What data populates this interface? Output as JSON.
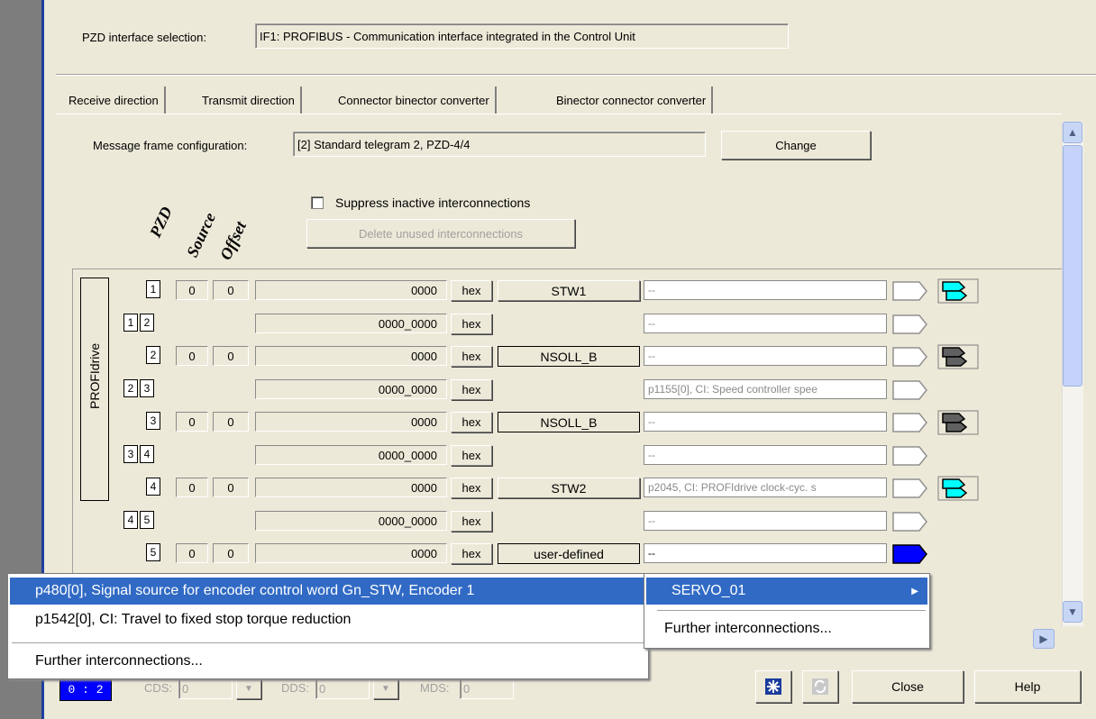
{
  "pzd_interface": {
    "label": "PZD interface selection:",
    "value": "IF1: PROFIBUS - Communication interface integrated in the Control Unit"
  },
  "tabs": [
    {
      "label": "Receive direction",
      "active": true
    },
    {
      "label": "Transmit direction",
      "active": false
    },
    {
      "label": "Connector binector converter",
      "active": false
    },
    {
      "label": "Binector connector converter",
      "active": false
    }
  ],
  "message_frame": {
    "label": "Message frame configuration:",
    "value": "[2] Standard telegram 2, PZD-4/4",
    "change_label": "Change"
  },
  "column_headers": {
    "pzd": "PZD",
    "source": "Source",
    "offset": "Offset"
  },
  "suppress_inactive": {
    "label": "Suppress inactive interconnections",
    "checked": false
  },
  "delete_unused_label": "Delete unused interconnections",
  "profidrive_label": "PROFIdrive",
  "rows": [
    {
      "kind": "word",
      "pzd": "1",
      "source": "0",
      "offset": "0",
      "value": "0000",
      "hex": "hex",
      "signal": "STW1",
      "signal_boxed": false,
      "interconnection": "--",
      "icon": "cyan"
    },
    {
      "kind": "dword",
      "pzd_a": "1",
      "pzd_b": "2",
      "value": "0000_0000",
      "hex": "hex",
      "interconnection": "--"
    },
    {
      "kind": "word",
      "pzd": "2",
      "source": "0",
      "offset": "0",
      "value": "0000",
      "hex": "hex",
      "signal": "NSOLL_B",
      "signal_boxed": true,
      "interconnection": "--",
      "icon": "gray"
    },
    {
      "kind": "dword",
      "pzd_a": "2",
      "pzd_b": "3",
      "value": "0000_0000",
      "hex": "hex",
      "interconnection": "p1155[0], CI: Speed controller spee"
    },
    {
      "kind": "word",
      "pzd": "3",
      "source": "0",
      "offset": "0",
      "value": "0000",
      "hex": "hex",
      "signal": "NSOLL_B",
      "signal_boxed": true,
      "interconnection": "--",
      "icon": "gray"
    },
    {
      "kind": "dword",
      "pzd_a": "3",
      "pzd_b": "4",
      "value": "0000_0000",
      "hex": "hex",
      "interconnection": "--"
    },
    {
      "kind": "word",
      "pzd": "4",
      "source": "0",
      "offset": "0",
      "value": "0000",
      "hex": "hex",
      "signal": "STW2",
      "signal_boxed": false,
      "interconnection": "p2045, CI: PROFIdrive clock-cyc. s",
      "icon": "cyan"
    },
    {
      "kind": "dword",
      "pzd_a": "4",
      "pzd_b": "5",
      "value": "0000_0000",
      "hex": "hex",
      "interconnection": "--"
    },
    {
      "kind": "word",
      "pzd": "5",
      "source": "0",
      "offset": "0",
      "value": "0000",
      "hex": "hex",
      "signal": "user-defined",
      "signal_boxed": true,
      "interconnection": "--",
      "icon": "none",
      "active": true
    }
  ],
  "context_menu_left": {
    "items": [
      "p480[0], Signal source for encoder control word Gn_STW, Encoder 1",
      "p1542[0], CI: Travel to fixed stop torque reduction"
    ],
    "further": "Further interconnections..."
  },
  "context_menu_right": {
    "item": "SERVO_01",
    "further": "Further interconnections..."
  },
  "status_bar": {
    "counter": "0 : 2",
    "cds_label": "CDS:",
    "cds_value": "0",
    "dds_label": "DDS:",
    "dds_value": "0",
    "mds_label": "MDS:",
    "mds_value": "0",
    "close_label": "Close",
    "help_label": "Help"
  },
  "colors": {
    "selection": "#316ac5",
    "dialog_bg": "#ece9d8",
    "cyan_icon": "#00ffff",
    "active_tag": "#0000ff"
  }
}
